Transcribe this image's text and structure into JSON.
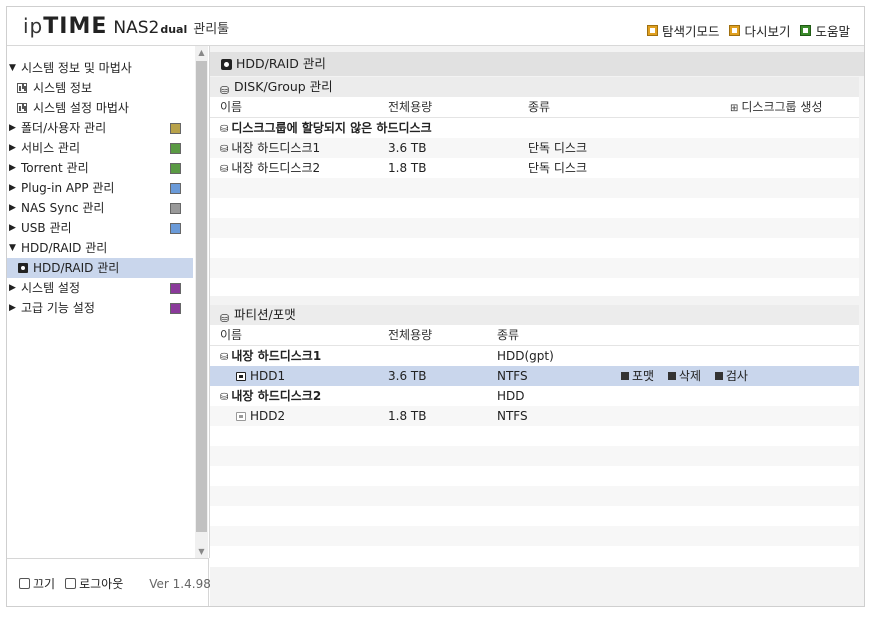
{
  "header": {
    "logo_ip": "ip",
    "logo_time": "TIME",
    "logo_nas": "NAS2",
    "logo_dual": "dual",
    "logo_tool": "관리툴",
    "links": [
      {
        "label": "탐색기모드",
        "icon": "folder-icon"
      },
      {
        "label": "다시보기",
        "icon": "refresh-icon"
      },
      {
        "label": "도움말",
        "icon": "help-icon"
      }
    ]
  },
  "sidebar": {
    "items": [
      {
        "label": "시스템 정보 및 마법사",
        "level": 0,
        "expanded": true
      },
      {
        "label": "시스템 정보",
        "level": 1
      },
      {
        "label": "시스템 설정 마법사",
        "level": 1
      },
      {
        "label": "폴더/사용자 관리",
        "level": 0,
        "expanded": false
      },
      {
        "label": "서비스 관리",
        "level": 0,
        "expanded": false
      },
      {
        "label": "Torrent 관리",
        "level": 0,
        "expanded": false
      },
      {
        "label": "Plug-in APP 관리",
        "level": 0,
        "expanded": false
      },
      {
        "label": "NAS Sync 관리",
        "level": 0,
        "expanded": false
      },
      {
        "label": "USB 관리",
        "level": 0,
        "expanded": false
      },
      {
        "label": "HDD/RAID 관리",
        "level": 0,
        "expanded": true
      },
      {
        "label": "HDD/RAID 관리",
        "level": 1,
        "selected": true
      },
      {
        "label": "시스템 설정",
        "level": 0,
        "expanded": false
      },
      {
        "label": "고급 기능 설정",
        "level": 0,
        "expanded": false
      }
    ],
    "footer": {
      "power_label": "끄기",
      "logout_label": "로그아웃",
      "version": "Ver 1.4.98"
    }
  },
  "main": {
    "title": "HDD/RAID 관리",
    "disk_group": {
      "title": "DISK/Group 관리",
      "columns": [
        "이름",
        "전체용량",
        "종류"
      ],
      "create_label": "디스크그룹 생성",
      "rows": [
        {
          "name": "디스크그룹에 할당되지 않은 하드디스크",
          "capacity": "",
          "type": "",
          "bold": true
        },
        {
          "name": "내장 하드디스크1",
          "capacity": "3.6 TB",
          "type": "단독 디스크"
        },
        {
          "name": "내장 하드디스크2",
          "capacity": "1.8 TB",
          "type": "단독 디스크"
        }
      ]
    },
    "partition": {
      "title": "파티션/포맷",
      "columns": [
        "이름",
        "전체용량",
        "종류"
      ],
      "rows": [
        {
          "name": "내장 하드디스크1",
          "capacity": "",
          "type": "HDD(gpt)",
          "bold": true
        },
        {
          "name": "HDD1",
          "capacity": "3.6 TB",
          "type": "NTFS",
          "selected": true
        },
        {
          "name": "내장 하드디스크2",
          "capacity": "",
          "type": "HDD",
          "bold": true
        },
        {
          "name": "HDD2",
          "capacity": "1.8 TB",
          "type": "NTFS"
        }
      ],
      "actions": [
        "포맷",
        "삭제",
        "검사"
      ]
    }
  }
}
